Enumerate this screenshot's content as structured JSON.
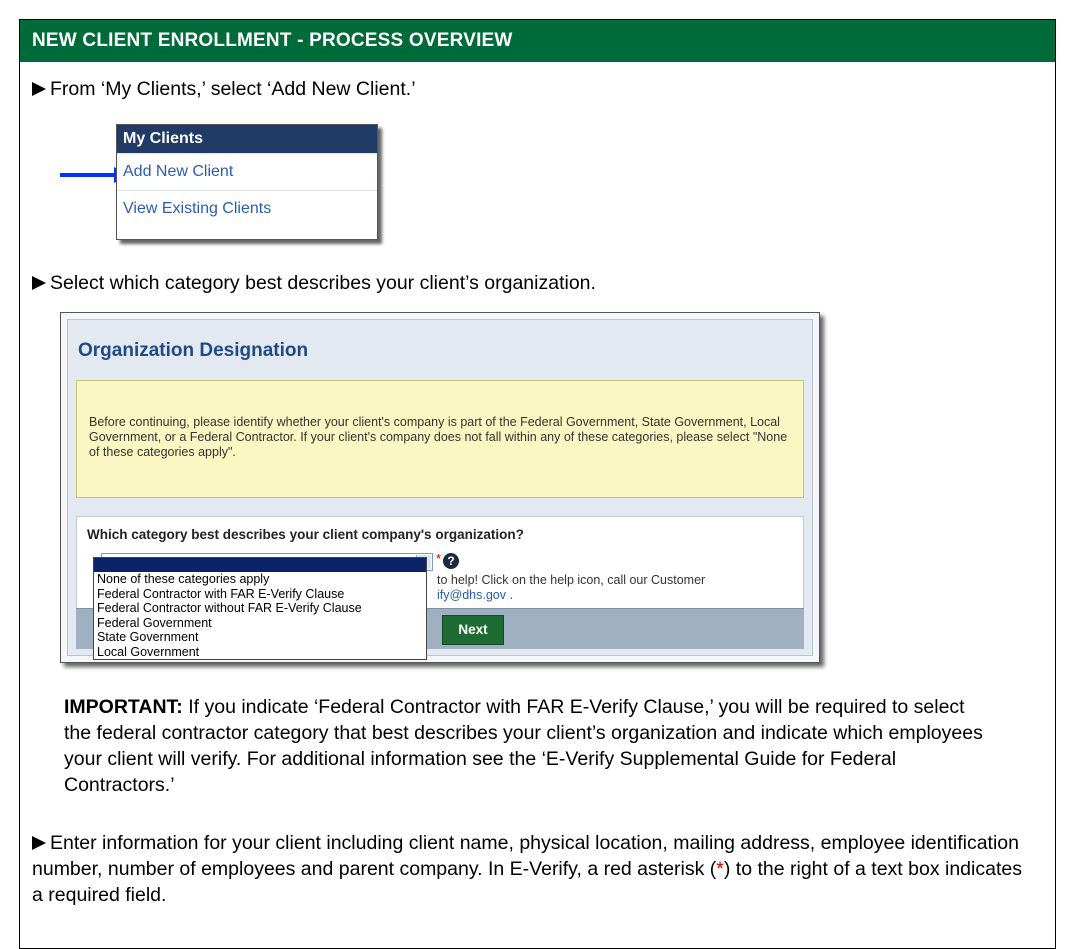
{
  "header": {
    "title": "NEW CLIENT ENROLLMENT - PROCESS OVERVIEW"
  },
  "steps": {
    "step1": "From ‘My Clients,’ select ‘Add New Client.’",
    "step2": "Select which category best describes your client’s organization.",
    "step3_part1": "Enter information for your client including client name, physical location, mailing address, employee identification number, number of employees and parent company. In E-Verify, a red asterisk (",
    "step3_asterisk": "*",
    "step3_part2": ") to the right of a text box indicates a required field."
  },
  "menu": {
    "title": "My Clients",
    "items": [
      "Add New Client",
      "View Existing Clients"
    ]
  },
  "dialog": {
    "title": "Organization Designation",
    "note": "Before continuing, please identify whether your client's company is part of the Federal Government, State Government, Local Government, or a Federal Contractor. If your client's company does not fall within any of these categories, please select \"None of these categories apply\".",
    "question": "Which category best describes your client company's organization?",
    "required_mark": "*",
    "help_icon": "?",
    "help_line1": "to help! Click on the help icon, call our Customer",
    "help_link": "ify@dhs.gov",
    "help_end": ".",
    "options": [
      "",
      "None of these categories apply",
      "Federal Contractor with FAR E-Verify Clause",
      "Federal Contractor without FAR E-Verify Clause",
      "Federal Government",
      "State Government",
      "Local Government"
    ],
    "next_label": "Next"
  },
  "important": {
    "label": "IMPORTANT:",
    "text": " If you indicate ‘Federal Contractor with FAR E-Verify Clause,’ you will be required to select the federal contractor category that best describes your client’s organization and indicate which employees your client will verify. For additional information see the ‘E-Verify Supplemental Guide for Federal Contractors.’"
  },
  "colors": {
    "header_green": "#006b3a",
    "menu_navy": "#1f3b66",
    "link_blue": "#2a5db0",
    "arrow_blue": "#0033ff",
    "required_red": "#cc0000"
  }
}
